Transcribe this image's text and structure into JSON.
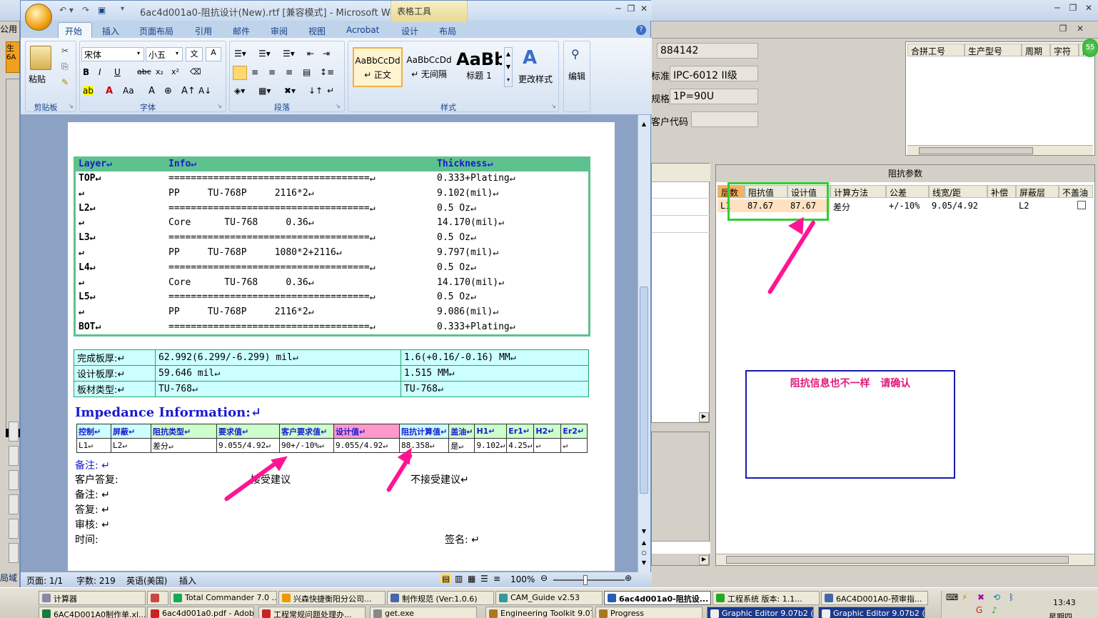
{
  "bg_app": {
    "left_fragment": "公用",
    "left_tab1": "生",
    "left_tab2": "6A",
    "bottom_left": "局域",
    "field_labels": [
      "",
      "标准",
      "规格",
      "客户代码"
    ],
    "field_values": [
      "884142",
      "IPC-6012 II级",
      "1P=90U",
      ""
    ],
    "top_grid_headers": [
      "合拼工号",
      "生产型号",
      "周期",
      "字符",
      "阻"
    ],
    "badge": "55",
    "impedance_panel_title": "阻抗参数",
    "imp_headers": [
      "层数",
      "阻抗值",
      "设计值",
      "计算方法",
      "公差",
      "线宽/距",
      "补偿",
      "屏蔽层",
      "不盖油"
    ],
    "imp_row": [
      "L1",
      "87.67",
      "87.67",
      "差分",
      "+/-10%",
      "9.05/4.92",
      "",
      "L2",
      ""
    ],
    "note_box": "阻抗信息也不一样   请确认"
  },
  "word": {
    "title": "6ac4d001a0-阻抗设计(New).rtf [兼容模式] - Microsoft Wo...",
    "table_tools": "表格工具",
    "tabs": [
      "开始",
      "插入",
      "页面布局",
      "引用",
      "邮件",
      "审阅",
      "视图",
      "Acrobat",
      "设计",
      "布局"
    ],
    "font_name": "宋体",
    "font_size": "小五",
    "groups": [
      "剪贴板",
      "字体",
      "段落",
      "样式",
      "编辑"
    ],
    "paste_label": "粘贴",
    "styles": [
      {
        "sample": "AaBbCcDd",
        "name": "↵ 正文"
      },
      {
        "sample": "AaBbCcDd",
        "name": "↵ 无间隔"
      },
      {
        "sample": "AaBb",
        "name": "标题 1"
      }
    ],
    "change_styles": "更改样式",
    "edit_label": "编辑",
    "status_page": "页面: 1/1",
    "status_words": "字数: 219",
    "status_lang": "英语(美国)",
    "status_mode": "插入",
    "zoom": "100%"
  },
  "doc": {
    "layer_headers": [
      "Layer↵",
      "Info↵",
      "Thickness↵"
    ],
    "layers": [
      {
        "layer": "TOP↵",
        "info": "====================================↵",
        "thick": "0.333+Plating↵"
      },
      {
        "layer": "↵",
        "info": "PP     TU-768P     2116*2↵",
        "thick": "9.102(mil)↵"
      },
      {
        "layer": "L2↵",
        "info": "====================================↵",
        "thick": "0.5 Oz↵"
      },
      {
        "layer": "↵",
        "info": "Core      TU-768     0.36↵",
        "thick": "14.170(mil)↵"
      },
      {
        "layer": "L3↵",
        "info": "====================================↵",
        "thick": "0.5 Oz↵"
      },
      {
        "layer": "↵",
        "info": "PP     TU-768P     1080*2+2116↵",
        "thick": "9.797(mil)↵"
      },
      {
        "layer": "L4↵",
        "info": "====================================↵",
        "thick": "0.5 Oz↵"
      },
      {
        "layer": "↵",
        "info": "Core      TU-768     0.36↵",
        "thick": "14.170(mil)↵"
      },
      {
        "layer": "L5↵",
        "info": "====================================↵",
        "thick": "0.5 Oz↵"
      },
      {
        "layer": "↵",
        "info": "PP     TU-768P     2116*2↵",
        "thick": "9.086(mil)↵"
      },
      {
        "layer": "BOT↵",
        "info": "====================================↵",
        "thick": "0.333+Plating↵"
      }
    ],
    "board_rows": [
      [
        "完成板厚:↵",
        "62.992(6.299/-6.299) mil↵",
        "1.6(+0.16/-0.16) MM↵"
      ],
      [
        "设计板厚:↵",
        "59.646 mil↵",
        "1.515 MM↵"
      ],
      [
        "板材类型:↵",
        "TU-768↵",
        "TU-768↵"
      ]
    ],
    "imp_title": "Impedance Information:↵",
    "imp_headers": [
      "控制↵",
      "屏蔽↵",
      "阻抗类型↵",
      "要求值↵",
      "客户要求值↵",
      "设计值↵",
      "阻抗计算值↵",
      "盖油↵",
      "H1↵",
      "Er1↵",
      "H2↵",
      "Er2↵"
    ],
    "imp_values": [
      "L1↵",
      "L2↵",
      "差分↵",
      "9.055/4.92↵",
      "90+/-10%↵",
      "9.055/4.92↵",
      "88.358↵",
      "是↵",
      "9.102↵",
      "4.25↵",
      "↵",
      "↵"
    ],
    "notes": [
      "备注: ↵",
      "客户答复: ",
      "备注: ↵",
      "答复: ↵",
      "审核: ↵",
      "时间: "
    ],
    "accept": "接受建议",
    "reject": "不接受建议↵",
    "sign": "签名: ↵"
  },
  "taskbar": {
    "row1": [
      "计算器",
      "",
      "Total Commander 7.0 ...",
      "兴森快捷衡阳分公司...",
      "制作规范 (Ver:1.0.6)",
      "CAM_Guide v2.53",
      "6ac4d001a0-阻抗设...",
      "工程系统  版本: 1.1...",
      "6AC4D001A0-预审指..."
    ],
    "row2": [
      "6AC4D001A0制作单.xl...",
      "6ac4d001a0.pdf - Adob...",
      "工程常规问题处理办...",
      "get.exe",
      "Engineering Toolkit 9.07...",
      "Progress",
      "Graphic Editor 9.07b2 (...",
      "Graphic Editor 9.07b2 (..."
    ],
    "clock": "13:43",
    "day": "星期四"
  },
  "colors": {
    "accent": "#ff1493",
    "table_green": "#2aa46a",
    "light_cyan": "#ccffff"
  }
}
